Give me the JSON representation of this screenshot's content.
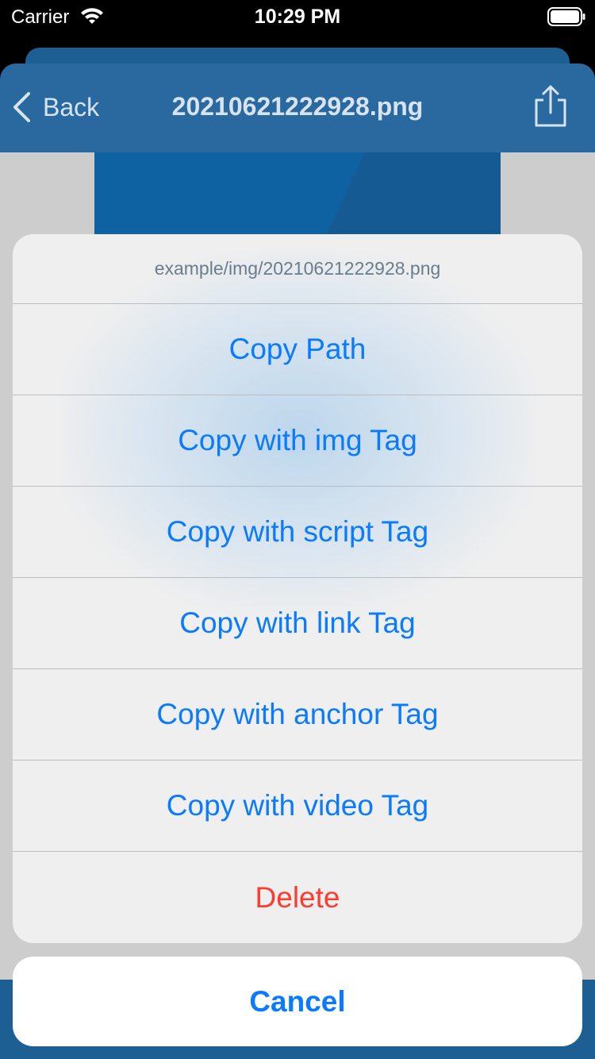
{
  "status_bar": {
    "carrier": "Carrier",
    "time": "10:29 PM",
    "icons": [
      "wifi-icon",
      "battery-icon"
    ]
  },
  "nav": {
    "back_label": "Back",
    "title": "20210621222928.png",
    "icons": [
      "chevron-left-icon",
      "share-icon"
    ]
  },
  "action_sheet": {
    "header": "example/img/20210621222928.png",
    "items": [
      {
        "label": "Copy Path"
      },
      {
        "label": "Copy with img Tag"
      },
      {
        "label": "Copy with script Tag"
      },
      {
        "label": "Copy with link Tag"
      },
      {
        "label": "Copy with anchor Tag"
      },
      {
        "label": "Copy with video Tag"
      },
      {
        "label": "Delete"
      }
    ],
    "cancel_label": "Cancel"
  },
  "colors": {
    "accent": "#0a7aff",
    "destructive": "#ff3b30",
    "nav_bar": "#2a69a0"
  }
}
